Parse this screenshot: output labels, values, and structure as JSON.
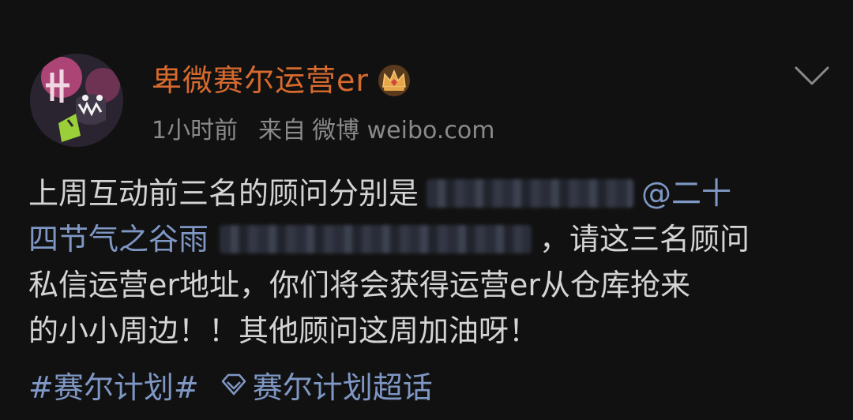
{
  "post": {
    "username": "卑微赛尔运营er",
    "badge_icon": "crown-icon",
    "time": "1小时前",
    "source_prefix": "来自",
    "source_name": "微博 weibo.com",
    "menu_icon": "chevron-down-icon",
    "content": {
      "line1_text": "上周互动前三名的顾问分别是",
      "line1_mention": "@二十",
      "line2_mention": "四节气之谷雨",
      "line2_text": "，请这三名顾问",
      "line3_text": "私信运营er地址，你们将会获得运营er从仓库抢来",
      "line4_text": "的小小周边！！其他顾问这周加油呀！"
    },
    "hashtag": "#赛尔计划#",
    "super_topic_icon": "diamond-icon",
    "super_topic": "赛尔计划超话"
  },
  "colors": {
    "background": "#111111",
    "username": "#d76a2e",
    "link": "#7f97c4",
    "text": "#d4d4d4",
    "meta": "#8a8a8a"
  }
}
